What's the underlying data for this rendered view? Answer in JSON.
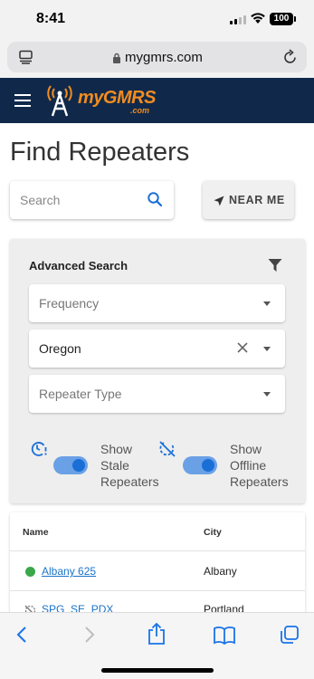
{
  "status_bar": {
    "time": "8:41",
    "battery": "100",
    "icons": [
      "signal-icon",
      "wifi-icon",
      "battery-icon"
    ]
  },
  "browser": {
    "url": "mygmrs.com",
    "icons": [
      "tabs-icon",
      "lock-icon",
      "reload-icon"
    ]
  },
  "header": {
    "logo_main": "myGMRS",
    "logo_sub": ".com",
    "icons": [
      "hamburger-menu-icon",
      "radio-tower-icon"
    ]
  },
  "page": {
    "title": "Find Repeaters"
  },
  "search": {
    "placeholder": "Search",
    "near_me_label": "NEAR ME",
    "icons": [
      "search-icon",
      "location-arrow-icon"
    ]
  },
  "advanced": {
    "title": "Advanced Search",
    "frequency_placeholder": "Frequency",
    "location_value": "Oregon",
    "type_placeholder": "Repeater Type",
    "toggles": [
      {
        "label_lines": [
          "Show",
          "Stale",
          "Repeaters"
        ],
        "on": true,
        "icon": "stale-clock-icon"
      },
      {
        "label_lines": [
          "Show",
          "Offline",
          "Repeaters"
        ],
        "on": true,
        "icon": "offline-icon"
      }
    ],
    "icons": [
      "filter-icon",
      "chevron-down-icon",
      "clear-icon"
    ]
  },
  "table": {
    "columns": [
      "Name",
      "City"
    ],
    "rows": [
      {
        "name": "Albany 625",
        "city": "Albany",
        "status": "online"
      },
      {
        "name": "SPG_SE_PDX",
        "city": "Portland",
        "status": "offline"
      }
    ]
  },
  "toolbar": {
    "icons": [
      "back-icon",
      "forward-icon",
      "share-icon",
      "bookmarks-icon",
      "tabs-overview-icon"
    ]
  },
  "colors": {
    "header_bg": "#10294b",
    "logo_orange": "#f28c1e",
    "accent_blue": "#1a6fd6",
    "online_green": "#3aa84a"
  }
}
